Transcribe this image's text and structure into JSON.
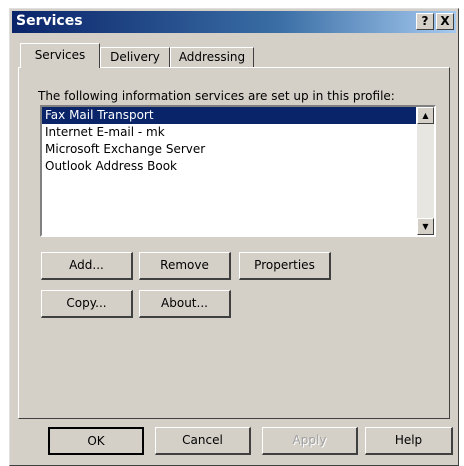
{
  "window": {
    "title": "Services",
    "help_button": "?",
    "close_button": "X"
  },
  "tabs": [
    {
      "label": "Services",
      "active": true
    },
    {
      "label": "Delivery",
      "active": false
    },
    {
      "label": "Addressing",
      "active": false
    }
  ],
  "services": {
    "description": "The following information services are set up in this profile:",
    "items": [
      {
        "label": "Fax Mail Transport",
        "selected": true
      },
      {
        "label": "Internet E-mail - mk",
        "selected": false
      },
      {
        "label": "Microsoft Exchange Server",
        "selected": false
      },
      {
        "label": "Outlook Address Book",
        "selected": false
      }
    ],
    "buttons": {
      "add": "Add...",
      "remove": "Remove",
      "properties": "Properties",
      "copy": "Copy...",
      "about": "About..."
    }
  },
  "footer": {
    "ok": "OK",
    "cancel": "Cancel",
    "apply": "Apply",
    "help": "Help"
  },
  "colors": {
    "dialog_face": "#d4d0c8",
    "title_bar": "#0a246a",
    "selection": "#0a246a"
  }
}
